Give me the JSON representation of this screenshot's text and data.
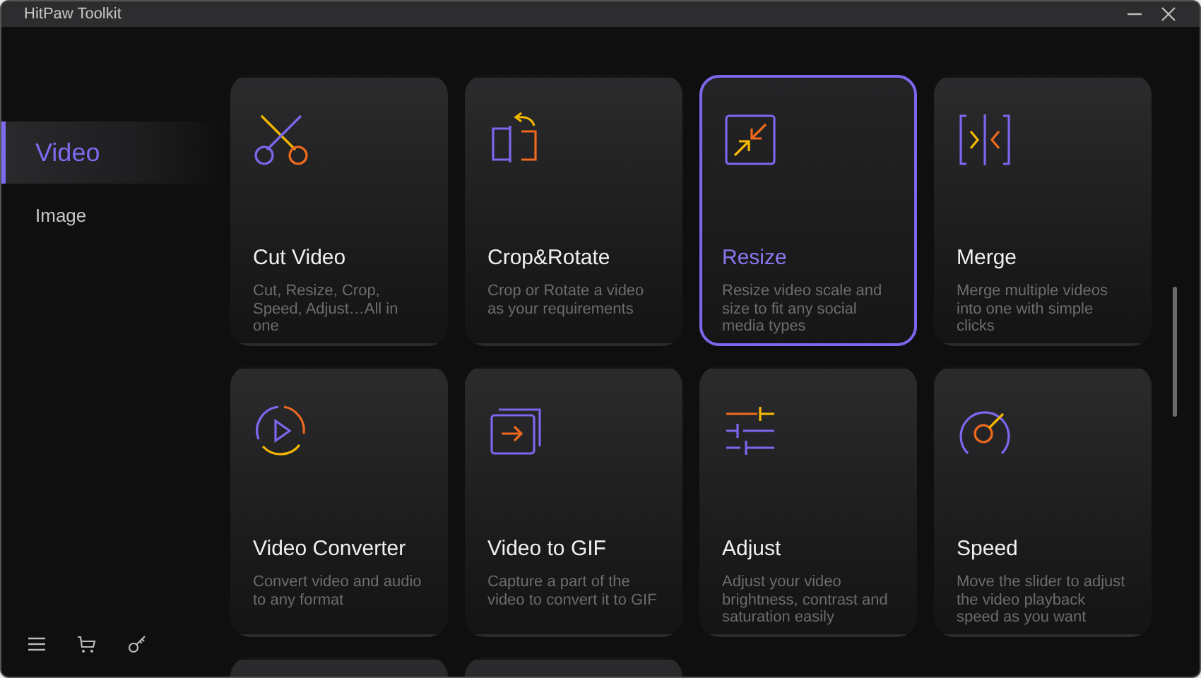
{
  "window": {
    "title": "HitPaw Toolkit"
  },
  "sidebar": {
    "items": [
      {
        "label": "Video",
        "selected": true
      },
      {
        "label": "Image",
        "selected": false
      }
    ]
  },
  "cards": [
    {
      "kind": "cut",
      "title": "Cut Video",
      "description": "Cut, Resize, Crop, Speed, Adjust…All in one",
      "selected": false
    },
    {
      "kind": "crop",
      "title": "Crop&Rotate",
      "description": "Crop or Rotate a video as your requirements",
      "selected": false
    },
    {
      "kind": "resize",
      "title": "Resize",
      "description": "Resize video scale and size to fit any social media types",
      "selected": true
    },
    {
      "kind": "merge",
      "title": "Merge",
      "description": "Merge multiple videos into one with simple clicks",
      "selected": false
    },
    {
      "kind": "convert",
      "title": "Video Converter",
      "description": "Convert video and audio to any format",
      "selected": false
    },
    {
      "kind": "gif",
      "title": "Video to GIF",
      "description": "Capture a part of the video to convert it to GIF",
      "selected": false
    },
    {
      "kind": "adjust",
      "title": "Adjust",
      "description": "Adjust your video brightness, contrast and saturation easily",
      "selected": false
    },
    {
      "kind": "speed",
      "title": "Speed",
      "description": "Move the slider to adjust the video playback speed as you want",
      "selected": false
    },
    {
      "kind": "blank",
      "selected": false
    },
    {
      "kind": "blank",
      "selected": false
    }
  ]
}
